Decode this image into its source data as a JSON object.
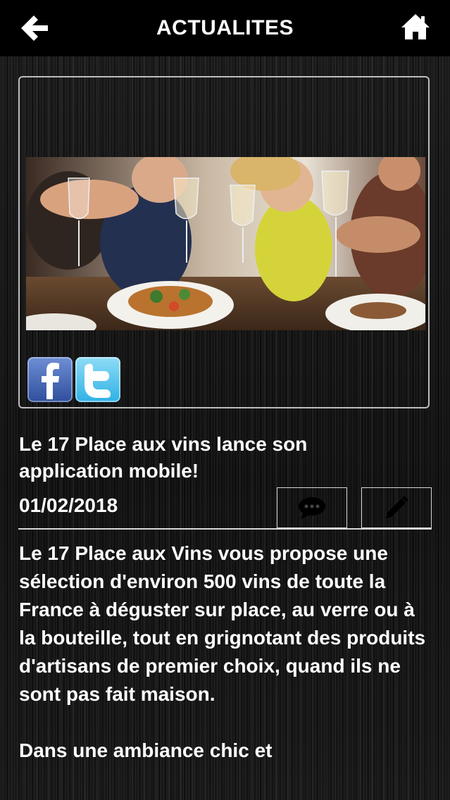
{
  "header": {
    "title": "ACTUALITES",
    "back_icon": "arrow-left-icon",
    "home_icon": "home-icon"
  },
  "article": {
    "share": {
      "facebook_icon": "facebook-icon",
      "twitter_icon": "twitter-icon"
    },
    "headline": "Le 17 Place aux vins lance son application mobile!",
    "date": "01/02/2018",
    "actions": {
      "comment_icon": "comment-icon",
      "edit_icon": "pencil-icon"
    },
    "body": "Le 17 Place aux Vins vous propose une sélection d'environ 500 vins de toute la France à déguster sur place, au verre ou à la bouteille, tout en grignotant des produits d'artisans de premier choix, quand ils ne sont pas fait maison.\n\nDans une ambiance chic et"
  }
}
